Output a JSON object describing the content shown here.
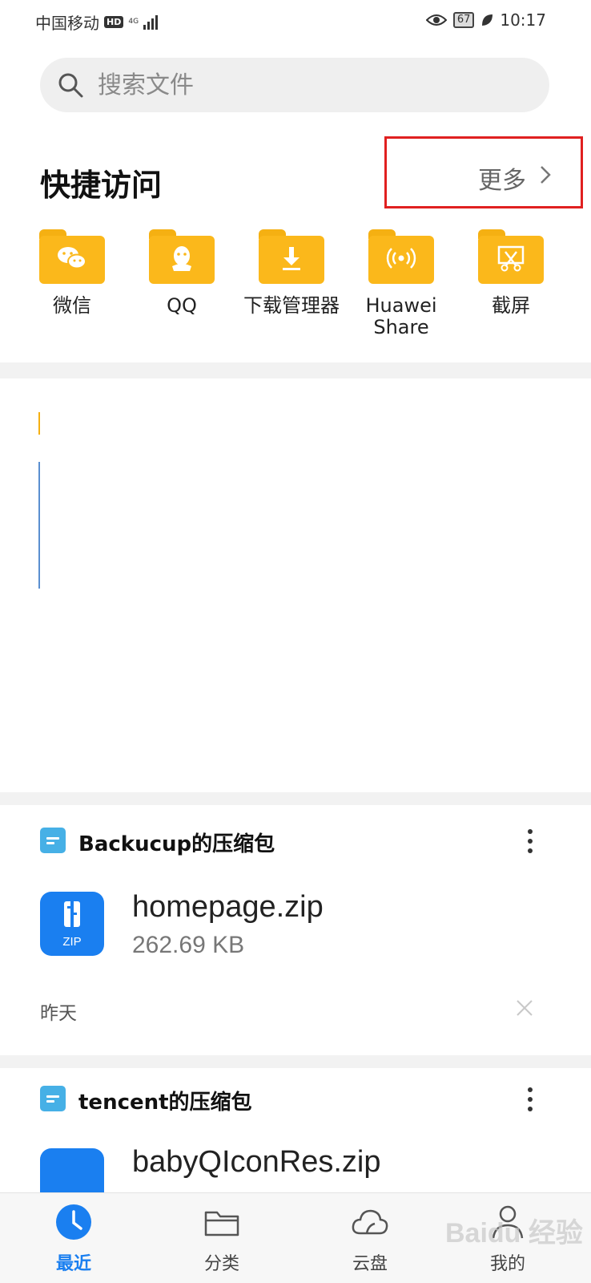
{
  "status_bar": {
    "carrier": "中国移动",
    "hd": "HD",
    "network": "4G",
    "battery": "67",
    "time": "10:17"
  },
  "search": {
    "placeholder": "搜索文件"
  },
  "quick_access": {
    "title": "快捷访问",
    "more_label": "更多",
    "items": [
      {
        "label": "微信",
        "icon": "wechat-icon"
      },
      {
        "label": "QQ",
        "icon": "qq-icon"
      },
      {
        "label": "下载管理器",
        "icon": "download-icon"
      },
      {
        "label": "Huawei Share",
        "icon": "huawei-share-icon"
      },
      {
        "label": "截屏",
        "icon": "screenshot-icon"
      }
    ]
  },
  "recent_cards": [
    {
      "title": "Backucup的压缩包",
      "file_name": "homepage.zip",
      "file_size": "262.69 KB",
      "file_type": "ZIP",
      "date": "昨天"
    },
    {
      "title": "tencent的压缩包",
      "file_name": "babyQIconRes.zip"
    }
  ],
  "bottom_nav": {
    "items": [
      {
        "label": "最近",
        "icon": "clock-icon",
        "active": true
      },
      {
        "label": "分类",
        "icon": "folder-icon"
      },
      {
        "label": "云盘",
        "icon": "cloud-icon"
      },
      {
        "label": "我的",
        "icon": "person-icon"
      }
    ]
  },
  "watermark": "Baidu 经验",
  "colors": {
    "accent": "#1a7ff0",
    "folder": "#fbb81b",
    "highlight_box": "#e02020"
  }
}
